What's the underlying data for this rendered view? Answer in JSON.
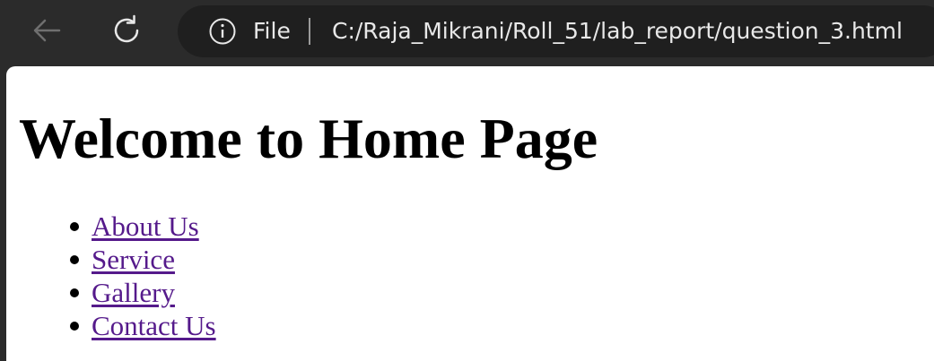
{
  "browser": {
    "site_info_label": "File",
    "url": "C:/Raja_Mikrani/Roll_51/lab_report/question_3.html",
    "icons": {
      "back": "back-arrow-icon",
      "reload": "reload-icon",
      "site_info": "info-icon"
    }
  },
  "page": {
    "heading": "Welcome to Home Page",
    "links": [
      {
        "label": "About Us"
      },
      {
        "label": "Service"
      },
      {
        "label": "Gallery"
      },
      {
        "label": "Contact Us"
      }
    ]
  },
  "colors": {
    "toolbar_bg": "#2b2b2b",
    "address_bar_bg": "#1f1f1f",
    "page_bg": "#ffffff",
    "visited_link": "#551a8b"
  }
}
